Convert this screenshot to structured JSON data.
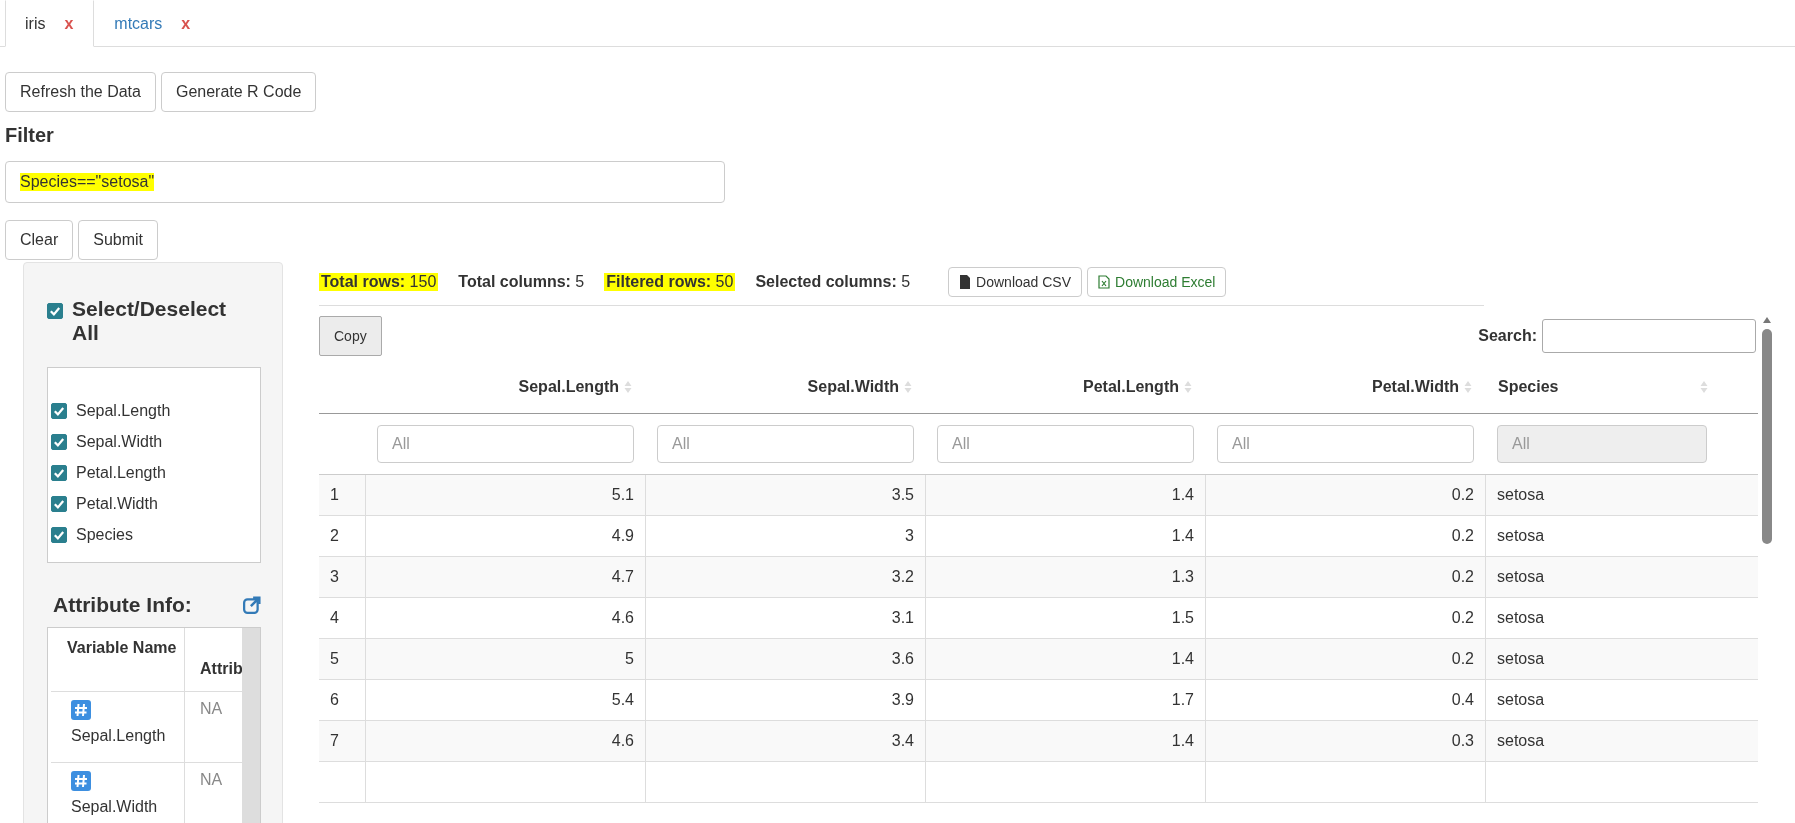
{
  "tabs": [
    {
      "label": "iris",
      "close": "x",
      "selected": true
    },
    {
      "label": "mtcars",
      "close": "x",
      "selected": false
    }
  ],
  "actions": [
    "Refresh the Data",
    "Generate R Code"
  ],
  "filter": {
    "heading": "Filter",
    "value": "Species==\"setosa\"",
    "highlighted": true
  },
  "filter_buttons": [
    "Clear",
    "Submit"
  ],
  "column_picker": {
    "select_all": {
      "label": "Select/Deselect All",
      "checked": true
    },
    "columns": [
      {
        "label": "Sepal.Length",
        "checked": true
      },
      {
        "label": "Sepal.Width",
        "checked": true
      },
      {
        "label": "Petal.Length",
        "checked": true
      },
      {
        "label": "Petal.Width",
        "checked": true
      },
      {
        "label": "Species",
        "checked": true
      }
    ]
  },
  "attribute_info": {
    "title": "Attribute Info:",
    "columns": [
      "Variable Name",
      "Attrib"
    ],
    "rows": [
      {
        "name": "Sepal.Length",
        "value": "NA"
      },
      {
        "name": "Sepal.Width",
        "value": "NA"
      }
    ]
  },
  "stats": [
    {
      "label": "Total rows:",
      "value": "150",
      "highlighted": true
    },
    {
      "label": "Total columns:",
      "value": "5",
      "highlighted": false
    },
    {
      "label": "Filtered rows:",
      "value": "50",
      "highlighted": true
    },
    {
      "label": "Selected columns:",
      "value": "5",
      "highlighted": false
    }
  ],
  "downloads": [
    {
      "label": "Download CSV",
      "kind": "csv"
    },
    {
      "label": "Download Excel",
      "kind": "excel"
    }
  ],
  "table": {
    "copy": "Copy",
    "search_label": "Search:",
    "columns": [
      {
        "label": "Sepal.Length",
        "kind": "numeric",
        "filter_placeholder": "All",
        "filter_disabled": false
      },
      {
        "label": "Sepal.Width",
        "kind": "numeric",
        "filter_placeholder": "All",
        "filter_disabled": false
      },
      {
        "label": "Petal.Length",
        "kind": "numeric",
        "filter_placeholder": "All",
        "filter_disabled": false
      },
      {
        "label": "Petal.Width",
        "kind": "numeric",
        "filter_placeholder": "All",
        "filter_disabled": false
      },
      {
        "label": "Species",
        "kind": "text",
        "filter_placeholder": "All",
        "filter_disabled": true
      }
    ],
    "rows": [
      {
        "number": "1",
        "cells": [
          "5.1",
          "3.5",
          "1.4",
          "0.2",
          "setosa"
        ]
      },
      {
        "number": "2",
        "cells": [
          "4.9",
          "3",
          "1.4",
          "0.2",
          "setosa"
        ]
      },
      {
        "number": "3",
        "cells": [
          "4.7",
          "3.2",
          "1.3",
          "0.2",
          "setosa"
        ]
      },
      {
        "number": "4",
        "cells": [
          "4.6",
          "3.1",
          "1.5",
          "0.2",
          "setosa"
        ]
      },
      {
        "number": "5",
        "cells": [
          "5",
          "3.6",
          "1.4",
          "0.2",
          "setosa"
        ]
      },
      {
        "number": "6",
        "cells": [
          "5.4",
          "3.9",
          "1.7",
          "0.4",
          "setosa"
        ]
      },
      {
        "number": "7",
        "cells": [
          "4.6",
          "3.4",
          "1.4",
          "0.3",
          "setosa"
        ]
      }
    ]
  }
}
